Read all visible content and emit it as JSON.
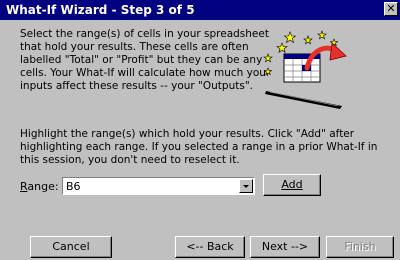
{
  "window": {
    "title": "What-If Wizard - Step 3 of 5",
    "close_glyph": "✕"
  },
  "intro_text": "Select the range(s) of cells in your spreadsheet that hold your results.  These cells are often labelled \"Total\" or \"Profit\" but they can be any cells.  Your What-If will calculate how much your inputs affect these results -- your \"Outputs\".",
  "instruction_text": "Highlight the range(s) which hold your results. Click \"Add\" after highlighting each range.  If you selected a range in a prior What-If in this session, you don't need to reselect it.",
  "range": {
    "label_underlined": "R",
    "label_rest": "ange:",
    "value": "B6"
  },
  "buttons": {
    "add": "Add",
    "cancel": "Cancel",
    "back": "<-- Back",
    "next": "Next -->",
    "finish": "Finish"
  },
  "illustration": {
    "icon": "spreadsheet-output-icon",
    "colors": {
      "arrow": "#e8302a",
      "star": "#ffff00",
      "header": "#000080",
      "pen": "#000000"
    }
  }
}
